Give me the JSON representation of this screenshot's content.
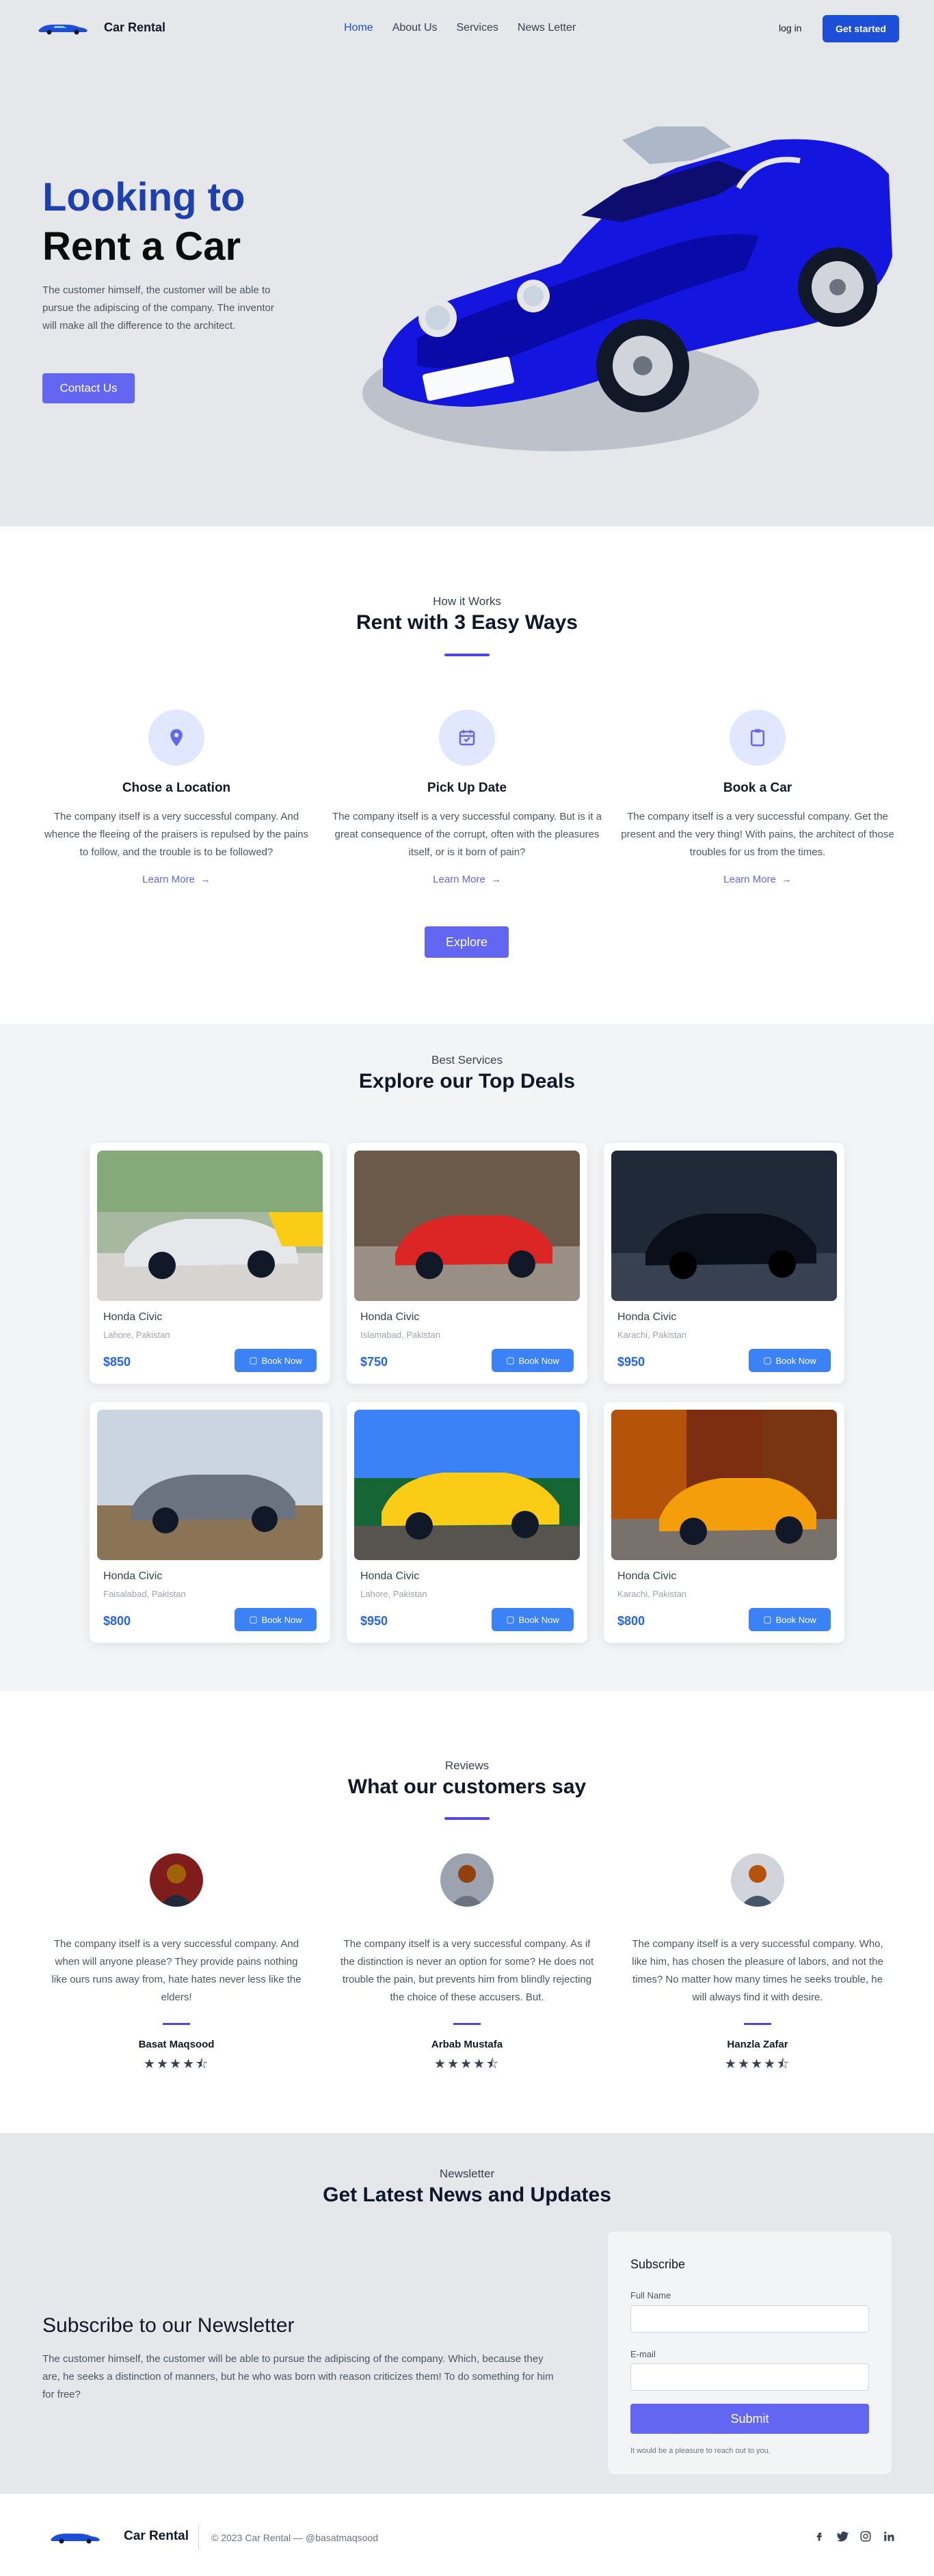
{
  "header": {
    "brand_name": "Car Rental",
    "nav": [
      "Home",
      "About Us",
      "Services",
      "News Letter"
    ],
    "login": "log in",
    "cta": "Get started"
  },
  "hero": {
    "title_line1": "Looking to",
    "title_line2": "Rent a Car",
    "description": "The customer himself, the customer will be able to pursue the adipiscing of the company. The inventor will make all the difference to the architect.",
    "button": "Contact Us"
  },
  "how_it_works": {
    "kicker": "How it Works",
    "title": "Rent with 3 Easy Ways",
    "steps": [
      {
        "icon": "location-pin-icon",
        "title": "Chose a Location",
        "text": "The company itself is a very successful company. And whence the fleeing of the praisers is repulsed by the pains to follow, and the trouble is to be followed?",
        "link": "Learn More"
      },
      {
        "icon": "calendar-check-icon",
        "title": "Pick Up Date",
        "text": "The company itself is a very successful company. But is it a great consequence of the corrupt, often with the pleasures itself, or is it born of pain?",
        "link": "Learn More"
      },
      {
        "icon": "clipboard-icon",
        "title": "Book a Car",
        "text": "The company itself is a very successful company. Get the present and the very thing! With pains, the architect of those troubles for us from the times.",
        "link": "Learn More"
      }
    ],
    "button": "Explore"
  },
  "deals": {
    "kicker": "Best Services",
    "title": "Explore our Top Deals",
    "cards": [
      {
        "name": "Honda Civic",
        "location": "Lahore, Pakistan",
        "price": "$850",
        "button": "Book Now",
        "color": "#e5e7eb"
      },
      {
        "name": "Honda Civic",
        "location": "Islamabad, Pakistan",
        "price": "$750",
        "button": "Book Now",
        "color": "#dc2626"
      },
      {
        "name": "Honda Civic",
        "location": "Karachi, Pakistan",
        "price": "$950",
        "button": "Book Now",
        "color": "#111827"
      },
      {
        "name": "Honda Civic",
        "location": "Faisalabad, Pakistan",
        "price": "$800",
        "button": "Book Now",
        "color": "#6b7280"
      },
      {
        "name": "Honda Civic",
        "location": "Lahore, Pakistan",
        "price": "$950",
        "button": "Book Now",
        "color": "#facc15"
      },
      {
        "name": "Honda Civic",
        "location": "Karachi, Pakistan",
        "price": "$800",
        "button": "Book Now",
        "color": "#f59e0b"
      }
    ]
  },
  "reviews": {
    "kicker": "Reviews",
    "title": "What our customers say",
    "items": [
      {
        "text": "The company itself is a very successful company. And when will anyone please? They provide pains nothing like ours runs away from, hate hates never less like the elders!",
        "name": "Basat Maqsood",
        "stars": "★★★★⯪"
      },
      {
        "text": "The company itself is a very successful company. As if the distinction is never an option for some? He does not trouble the pain, but prevents him from blindly rejecting the choice of these accusers. But.",
        "name": "Arbab Mustafa",
        "stars": "★★★★⯪"
      },
      {
        "text": "The company itself is a very successful company. Who, like him, has chosen the pleasure of labors, and not the times? No matter how many times he seeks trouble, he will always find it with desire.",
        "name": "Hanzla Zafar",
        "stars": "★★★★⯪"
      }
    ]
  },
  "newsletter": {
    "kicker": "Newsletter",
    "title": "Get Latest News and Updates",
    "left_title": "Subscribe to our Newsletter",
    "left_desc": "The customer himself, the customer will be able to pursue the adipiscing of the company. Which, because they are, he seeks a distinction of manners, but he who was born with reason criticizes them! To do something for him for free?",
    "box_title": "Subscribe",
    "full_name_label": "Full Name",
    "email_label": "E-mail",
    "submit": "Submit",
    "note": "It would be a pleasure to reach out to you."
  },
  "footer": {
    "brand_name": "Car Rental",
    "copyright": "© 2023 Car Rental — @basatmaqsood",
    "socials": [
      "facebook-icon",
      "twitter-icon",
      "instagram-icon",
      "linkedin-icon"
    ]
  },
  "colors": {
    "primary": "#1d4ed8",
    "accent": "#6366f1",
    "book_button": "#3b82f6"
  }
}
